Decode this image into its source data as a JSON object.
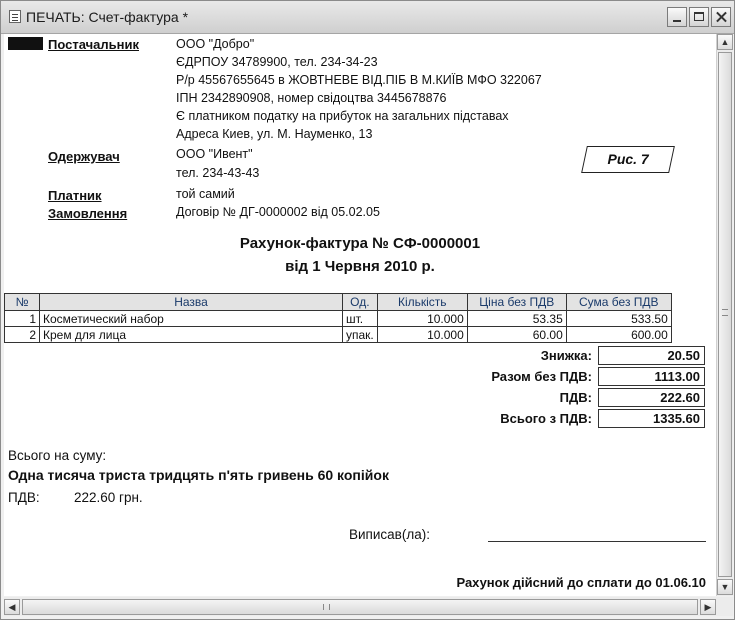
{
  "window": {
    "title": "ПЕЧАТЬ: Счет-фактура  *"
  },
  "supplier": {
    "label": "Постачальник",
    "lines": [
      "ООО \"Добро\"",
      "ЄДРПОУ 34789900, тел. 234-34-23",
      "Р/р 45567655645 в  ЖОВТНЕВЕ ВІД.ПІБ В М.КИЇВ МФО 322067",
      "ІПН 2342890908, номер свідоцтва 3445678876",
      "Є платником податку на прибуток на загальних підставах",
      "Адреса Киев, ул. М. Науменко, 13"
    ]
  },
  "recipient": {
    "label": "Одержувач",
    "lines": [
      "ООО \"Ивент\"",
      "тел. 234-43-43"
    ]
  },
  "payer": {
    "label": "Платник",
    "value": "той самий"
  },
  "order": {
    "label": "Замовлення",
    "value": "Договір № ДГ-0000002 від 05.02.05"
  },
  "figure_label": "Рис. 7",
  "invoice": {
    "title": "Рахунок-фактура № СФ-0000001",
    "date": "від 1 Червня 2010 р."
  },
  "table": {
    "headers": [
      "№",
      "Назва",
      "Од.",
      "Кількість",
      "Ціна без ПДВ",
      "Сума без ПДВ"
    ],
    "rows": [
      [
        "1",
        "Косметический набор",
        "шт.",
        "10.000",
        "53.35",
        "533.50"
      ],
      [
        "2",
        "Крем для лица",
        "упак.",
        "10.000",
        "60.00",
        "600.00"
      ]
    ]
  },
  "totals": {
    "discount_label": "Знижка:",
    "discount": "20.50",
    "subtotal_label": "Разом без ПДВ:",
    "subtotal": "1113.00",
    "vat_label": "ПДВ:",
    "vat": "222.60",
    "total_label": "Всього з ПДВ:",
    "total": "1335.60"
  },
  "amount": {
    "caption": "Всього на суму:",
    "words": "Одна тисяча триста тридцять п'ять гривень 60 копійок",
    "vat_caption": "ПДВ:",
    "vat_value": "222.60 грн."
  },
  "signature": {
    "label": "Виписав(ла):"
  },
  "footer": {
    "valid_until": "Рахунок дійсний до сплати до 01.06.10"
  },
  "scrollbar": {
    "up": "▲",
    "down": "▼",
    "left": "◀",
    "right": "▶"
  }
}
